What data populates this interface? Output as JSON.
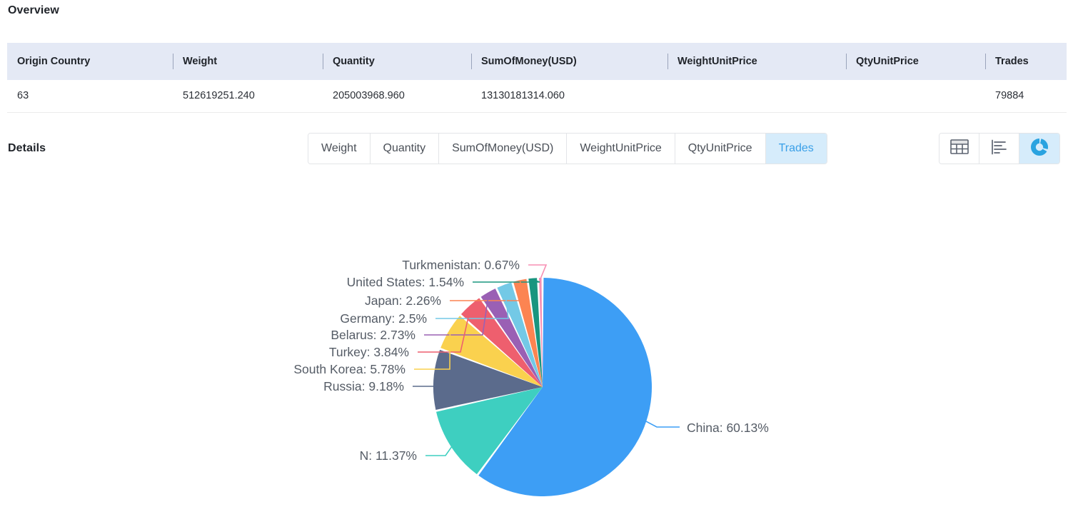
{
  "overview": {
    "title": "Overview",
    "columns": [
      "Origin Country",
      "Weight",
      "Quantity",
      "SumOfMoney(USD)",
      "WeightUnitPrice",
      "QtyUnitPrice",
      "Trades"
    ],
    "rows": [
      {
        "origin_country": "63",
        "weight": "512619251.240",
        "quantity": "205003968.960",
        "sum_of_money_usd": "13130181314.060",
        "weight_unit_price": "",
        "qty_unit_price": "",
        "trades": "79884"
      }
    ]
  },
  "details": {
    "title": "Details",
    "tabs": [
      {
        "label": "Weight",
        "active": false
      },
      {
        "label": "Quantity",
        "active": false
      },
      {
        "label": "SumOfMoney(USD)",
        "active": false
      },
      {
        "label": "WeightUnitPrice",
        "active": false
      },
      {
        "label": "QtyUnitPrice",
        "active": false
      },
      {
        "label": "Trades",
        "active": true
      }
    ],
    "view_toggle": [
      {
        "icon": "table-view-icon",
        "active": false
      },
      {
        "icon": "bar-chart-view-icon",
        "active": false
      },
      {
        "icon": "pie-chart-view-icon",
        "active": true
      }
    ]
  },
  "theme": {
    "header_bg": "#e4e9f5",
    "active_tab_bg": "#d6ecfb",
    "active_tab_fg": "#3aa0e8",
    "label_fg": "#555c66"
  },
  "chart_data": {
    "type": "pie",
    "title": "",
    "metric": "Trades",
    "legend_position": "none",
    "label_format": "{name}: {percent}%",
    "categories": [
      "China",
      "N",
      "Russia",
      "South Korea",
      "Turkey",
      "Belarus",
      "Germany",
      "Japan",
      "United States",
      "Turkmenistan"
    ],
    "values": [
      60.13,
      11.37,
      9.18,
      5.78,
      3.84,
      2.73,
      2.5,
      2.26,
      1.54,
      0.67
    ],
    "colors": [
      "#3d9ef5",
      "#3ecfc0",
      "#5b6b8c",
      "#fad14e",
      "#ee5f6e",
      "#9a60b4",
      "#73c9e6",
      "#fc8452",
      "#19957f",
      "#f78fb3"
    ],
    "labels": [
      "China: 60.13%",
      "N: 11.37%",
      "Russia: 9.18%",
      "South Korea: 5.78%",
      "Turkey: 3.84%",
      "Belarus: 2.73%",
      "Germany: 2.5%",
      "Japan: 2.26%",
      "United States: 1.54%",
      "Turkmenistan: 0.67%"
    ]
  }
}
